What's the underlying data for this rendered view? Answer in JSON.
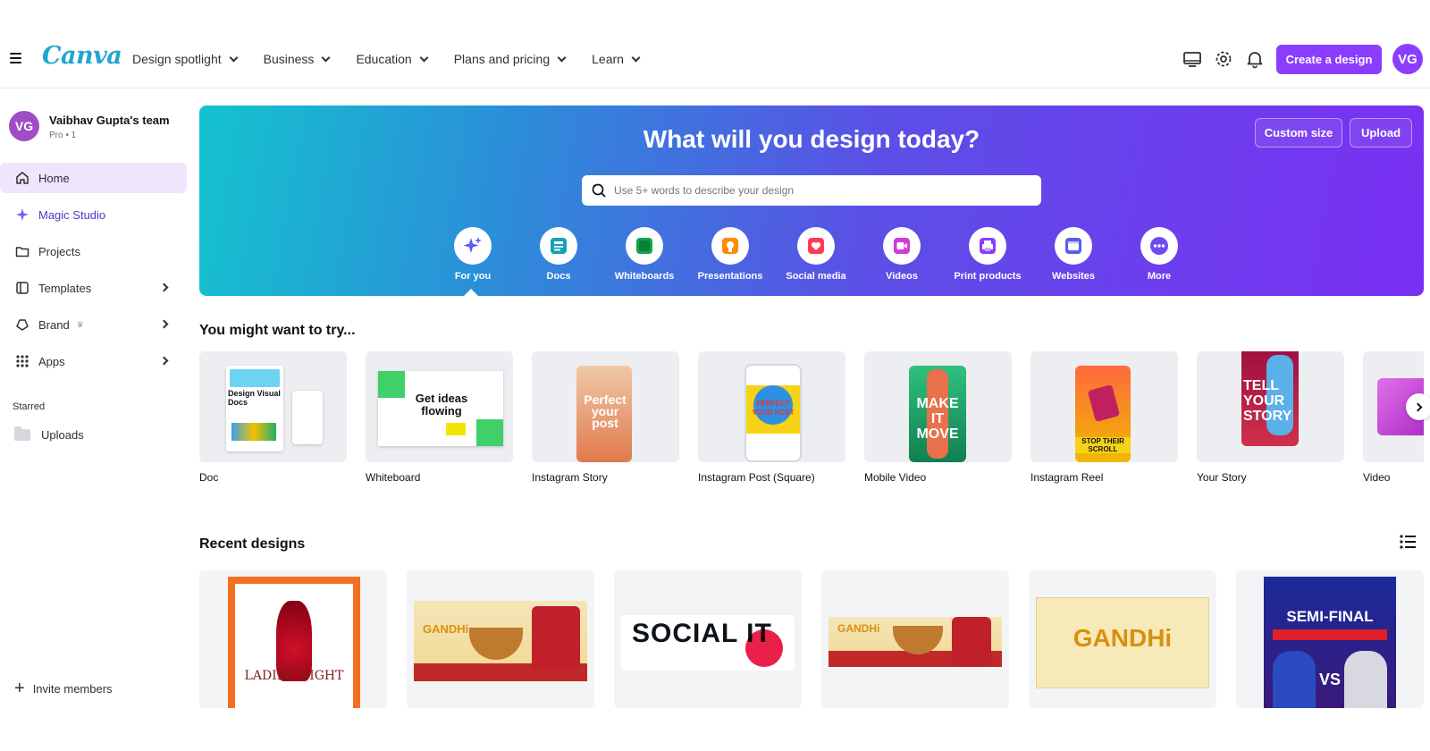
{
  "header": {
    "logo": "Canva",
    "nav": [
      {
        "label": "Design spotlight"
      },
      {
        "label": "Business"
      },
      {
        "label": "Education"
      },
      {
        "label": "Plans and pricing"
      },
      {
        "label": "Learn"
      }
    ],
    "create_label": "Create a design",
    "avatar_initials": "VG"
  },
  "sidebar": {
    "team_initials": "VG",
    "team_name": "Vaibhav Gupta's team",
    "team_meta": "Pro • 1",
    "items": [
      {
        "label": "Home",
        "icon": "home-icon"
      },
      {
        "label": "Magic Studio",
        "icon": "sparkle-icon"
      },
      {
        "label": "Projects",
        "icon": "folder-icon"
      },
      {
        "label": "Templates",
        "icon": "template-icon"
      },
      {
        "label": "Brand",
        "icon": "brand-icon"
      },
      {
        "label": "Apps",
        "icon": "apps-grid-icon"
      }
    ],
    "starred_label": "Starred",
    "uploads_label": "Uploads",
    "invite_label": "Invite members"
  },
  "hero": {
    "title": "What will you design today?",
    "custom_size_label": "Custom size",
    "upload_label": "Upload",
    "search_placeholder": "Use 5+ words to describe your design",
    "categories": [
      {
        "label": "For you",
        "color": "#5b5cf6"
      },
      {
        "label": "Docs",
        "color": "#13a3b5"
      },
      {
        "label": "Whiteboards",
        "color": "#0ba84a"
      },
      {
        "label": "Presentations",
        "color": "#ff8a00"
      },
      {
        "label": "Social media",
        "color": "#ff3b4e"
      },
      {
        "label": "Videos",
        "color": "#d13bdc"
      },
      {
        "label": "Print products",
        "color": "#8b3dff"
      },
      {
        "label": "Websites",
        "color": "#5a5cf0"
      },
      {
        "label": "More",
        "color": "#6f4cf2"
      }
    ]
  },
  "try_section": {
    "title": "You might want to try...",
    "items": [
      {
        "label": "Doc",
        "thumb_text": "Design Visual Docs"
      },
      {
        "label": "Whiteboard",
        "thumb_text": "Get ideas flowing"
      },
      {
        "label": "Instagram Story",
        "thumb_text": "Perfect your post"
      },
      {
        "label": "Instagram Post (Square)",
        "thumb_text": "PERFECT YOUR POST"
      },
      {
        "label": "Mobile Video",
        "thumb_text": "MAKE IT MOVE"
      },
      {
        "label": "Instagram Reel",
        "thumb_text": "STOP THEIR SCROLL"
      },
      {
        "label": "Your Story",
        "thumb_text": "TELL YOUR STORY"
      },
      {
        "label": "Video",
        "thumb_text": ""
      }
    ]
  },
  "recent_section": {
    "title": "Recent designs",
    "items": [
      {
        "thumb_text": "LADIES NIGHT"
      },
      {
        "thumb_text": "GANDHi"
      },
      {
        "thumb_text": "SOCIAL IT"
      },
      {
        "thumb_text": "GANDHi"
      },
      {
        "thumb_text": "GANDHi"
      },
      {
        "thumb_text": "SEMI-FINAL"
      }
    ]
  },
  "colors": {
    "brand_purple": "#8b3dff",
    "logo_teal": "#1fa6cf",
    "active_bg": "#efe6fd"
  }
}
